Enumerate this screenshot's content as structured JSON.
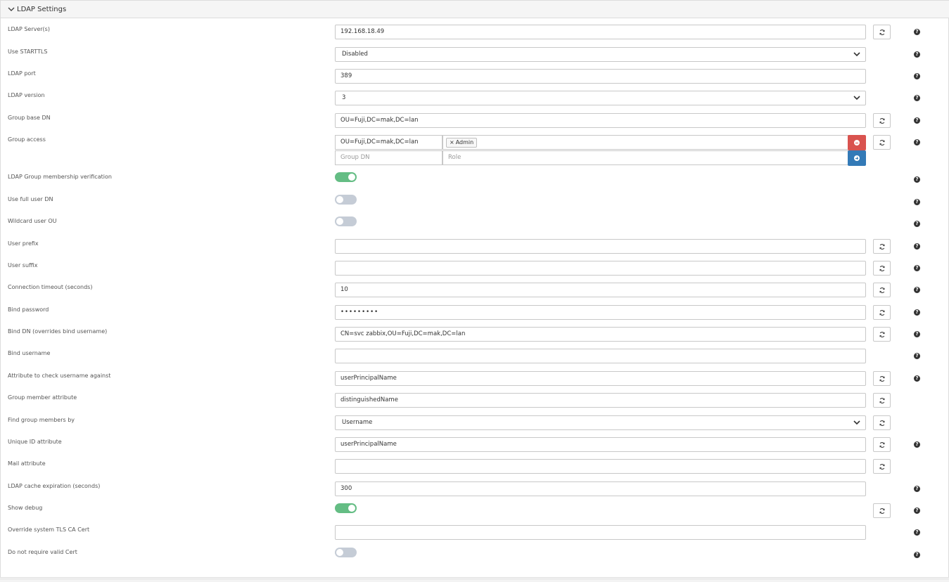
{
  "header": {
    "title": "LDAP Settings"
  },
  "rows": {
    "ldap_servers": {
      "label": "LDAP Server(s)",
      "value": "192.168.18.49"
    },
    "use_starttls": {
      "label": "Use STARTTLS",
      "value": "Disabled"
    },
    "ldap_port": {
      "label": "LDAP port",
      "value": "389"
    },
    "ldap_version": {
      "label": "LDAP version",
      "value": "3"
    },
    "group_base_dn": {
      "label": "Group base DN",
      "value": "OU=Fuji,DC=mak,DC=lan"
    },
    "group_access": {
      "label": "Group access",
      "dn_value": "OU=Fuji,DC=mak,DC=lan",
      "role_tag": "Admin",
      "new_dn_placeholder": "Group DN",
      "new_role_placeholder": "Role"
    },
    "group_membership_verification": {
      "label": "LDAP Group membership verification",
      "enabled": true
    },
    "use_full_user_dn": {
      "label": "Use full user DN",
      "enabled": false
    },
    "wildcard_user_ou": {
      "label": "Wildcard user OU",
      "enabled": false
    },
    "user_prefix": {
      "label": "User prefix",
      "value": ""
    },
    "user_suffix": {
      "label": "User suffix",
      "value": ""
    },
    "connection_timeout": {
      "label": "Connection timeout (seconds)",
      "value": "10"
    },
    "bind_password": {
      "label": "Bind password",
      "value": "•••••••••"
    },
    "bind_dn": {
      "label": "Bind DN (overrides bind username)",
      "value": "CN=svc zabbix,OU=Fuji,DC=mak,DC=lan"
    },
    "bind_username": {
      "label": "Bind username",
      "value": ""
    },
    "username_attribute": {
      "label": "Attribute to check username against",
      "value": "userPrincipalName"
    },
    "group_member_attribute": {
      "label": "Group member attribute",
      "value": "distinguishedName"
    },
    "find_group_members_by": {
      "label": "Find group members by",
      "value": "Username"
    },
    "unique_id_attribute": {
      "label": "Unique ID attribute",
      "value": "userPrincipalName"
    },
    "mail_attribute": {
      "label": "Mail attribute",
      "value": ""
    },
    "cache_expiration": {
      "label": "LDAP cache expiration (seconds)",
      "value": "300"
    },
    "show_debug": {
      "label": "Show debug",
      "enabled": true
    },
    "tls_ca_cert": {
      "label": "Override system TLS CA Cert",
      "value": ""
    },
    "no_valid_cert": {
      "label": "Do not require valid Cert",
      "enabled": false
    }
  },
  "icons": {
    "help": "?",
    "refresh": "refresh-icon",
    "collapse": "chevron-down-icon",
    "remove": "minus-circle-icon",
    "add": "plus-circle-icon"
  },
  "colors": {
    "toggle_on": "#64bd84",
    "toggle_off": "#c5ccd6",
    "danger": "#d9534f",
    "primary": "#337ab7"
  }
}
